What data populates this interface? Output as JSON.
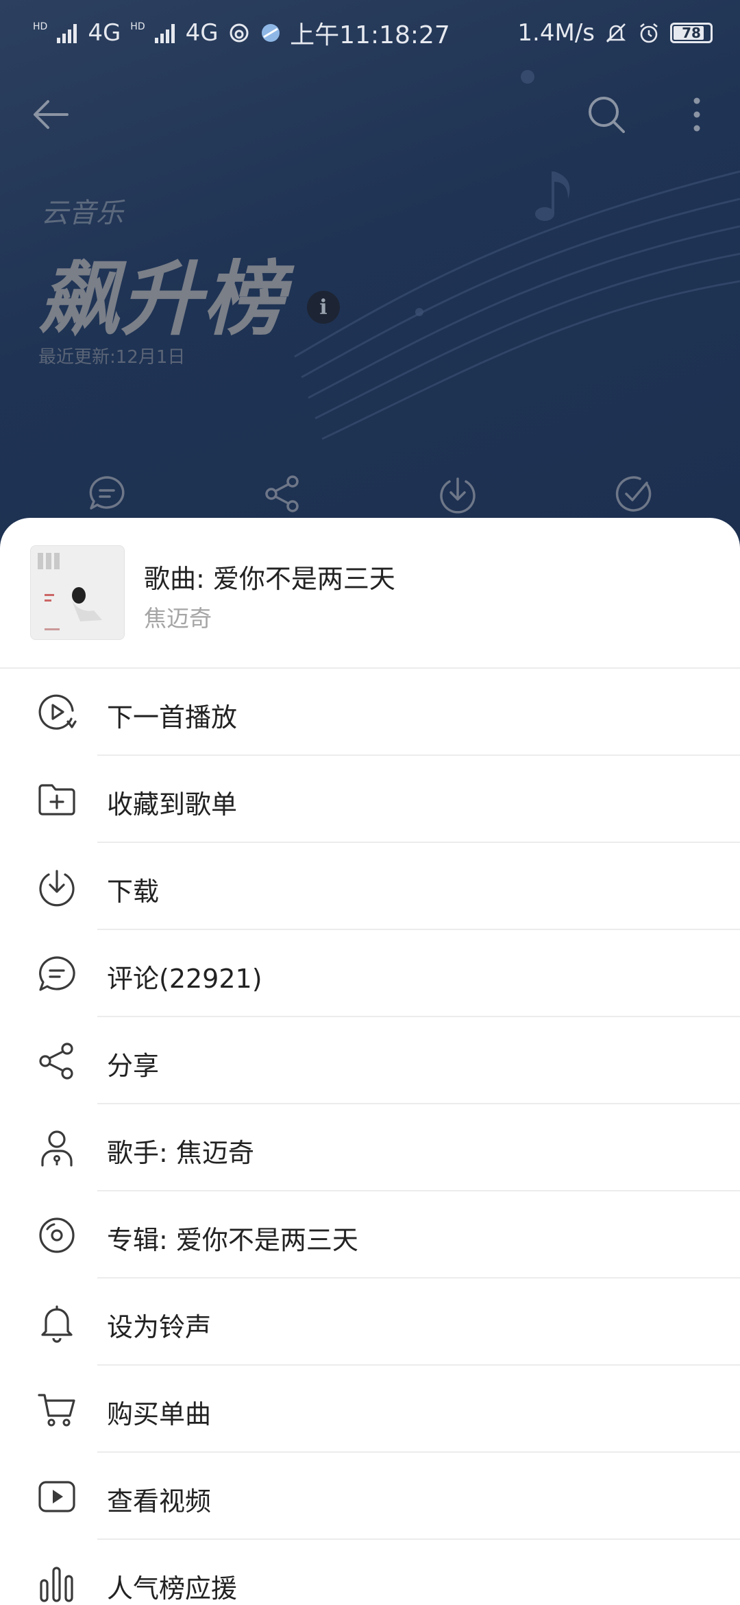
{
  "status_bar": {
    "network_1": "4G",
    "network_2": "4G",
    "hd_label": "HD",
    "time": "上午11:18:27",
    "speed": "1.4M/s",
    "battery": "78",
    "icons": [
      "signal-icon",
      "signal-icon",
      "netease-icon",
      "browser-icon",
      "mute-icon",
      "alarm-icon",
      "battery-icon"
    ]
  },
  "header": {
    "brand_sub": "云音乐",
    "brand_title": "飙升榜",
    "info_icon": "i",
    "update_text": "最近更新:12月1日",
    "icons": [
      "back-arrow-icon",
      "search-icon",
      "more-vertical-icon"
    ],
    "actions": [
      "comment-icon",
      "share-icon",
      "download-icon",
      "check-icon"
    ]
  },
  "sheet": {
    "song_title": "歌曲: 爱你不是两三天",
    "song_artist": "焦迈奇",
    "menu": [
      {
        "label": "下一首播放",
        "icon": "play-next-icon"
      },
      {
        "label": "收藏到歌单",
        "icon": "add-to-playlist-icon"
      },
      {
        "label": "下载",
        "icon": "download-icon"
      },
      {
        "label": "评论(22921)",
        "icon": "comment-icon"
      },
      {
        "label": "分享",
        "icon": "share-icon"
      },
      {
        "label": "歌手: 焦迈奇",
        "icon": "artist-icon"
      },
      {
        "label": "专辑: 爱你不是两三天",
        "icon": "album-icon"
      },
      {
        "label": "设为铃声",
        "icon": "bell-icon"
      },
      {
        "label": "购买单曲",
        "icon": "cart-icon"
      },
      {
        "label": "查看视频",
        "icon": "video-icon"
      },
      {
        "label": "人气榜应援",
        "icon": "bar-chart-icon"
      }
    ]
  },
  "colors": {
    "background": "#223148",
    "sheet": "#ffffff",
    "text_primary": "#222222",
    "text_secondary": "#a5a5a5",
    "icon": "#3a3a3a"
  }
}
